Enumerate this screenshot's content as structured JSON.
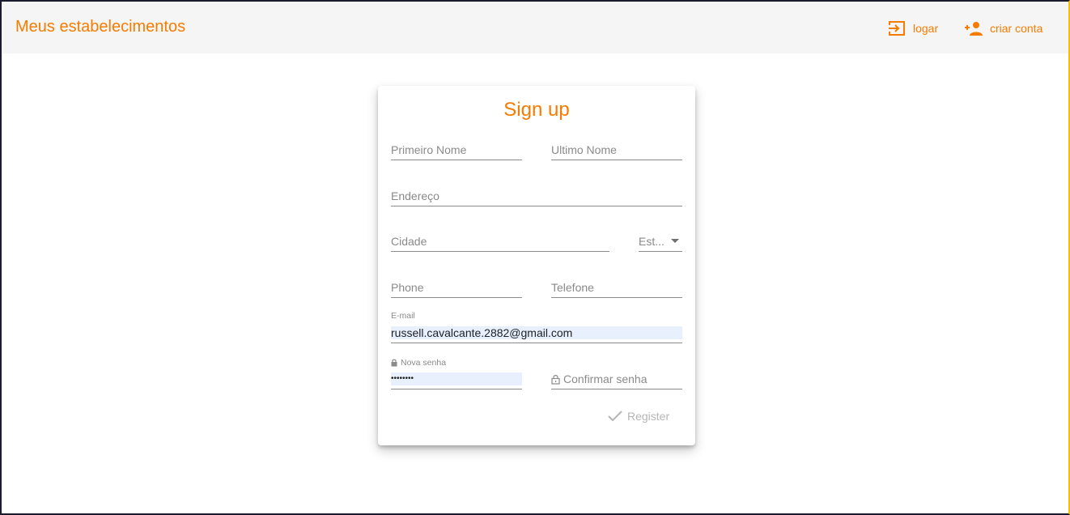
{
  "header": {
    "brand": "Meus estabelecimentos",
    "login_label": "logar",
    "signup_label": "criar conta",
    "accent_color": "#f57c00"
  },
  "form": {
    "title": "Sign up",
    "first_name_placeholder": "Primeiro Nome",
    "last_name_placeholder": "Ultimo Nome",
    "address_placeholder": "Endereço",
    "city_placeholder": "Cidade",
    "state_placeholder": "Est...",
    "phone_placeholder": "Phone",
    "telephone_placeholder": "Telefone",
    "email_label": "E-mail",
    "email_value": "russell.cavalcante.2882@gmail.com",
    "password_label": "Nova senha",
    "password_value": "••••••••",
    "confirm_password_placeholder": "Confirmar senha",
    "register_label": "Register"
  },
  "icons": {
    "login": "login-icon",
    "signup": "person-add-icon",
    "lock": "lock-icon",
    "check": "check-icon"
  }
}
